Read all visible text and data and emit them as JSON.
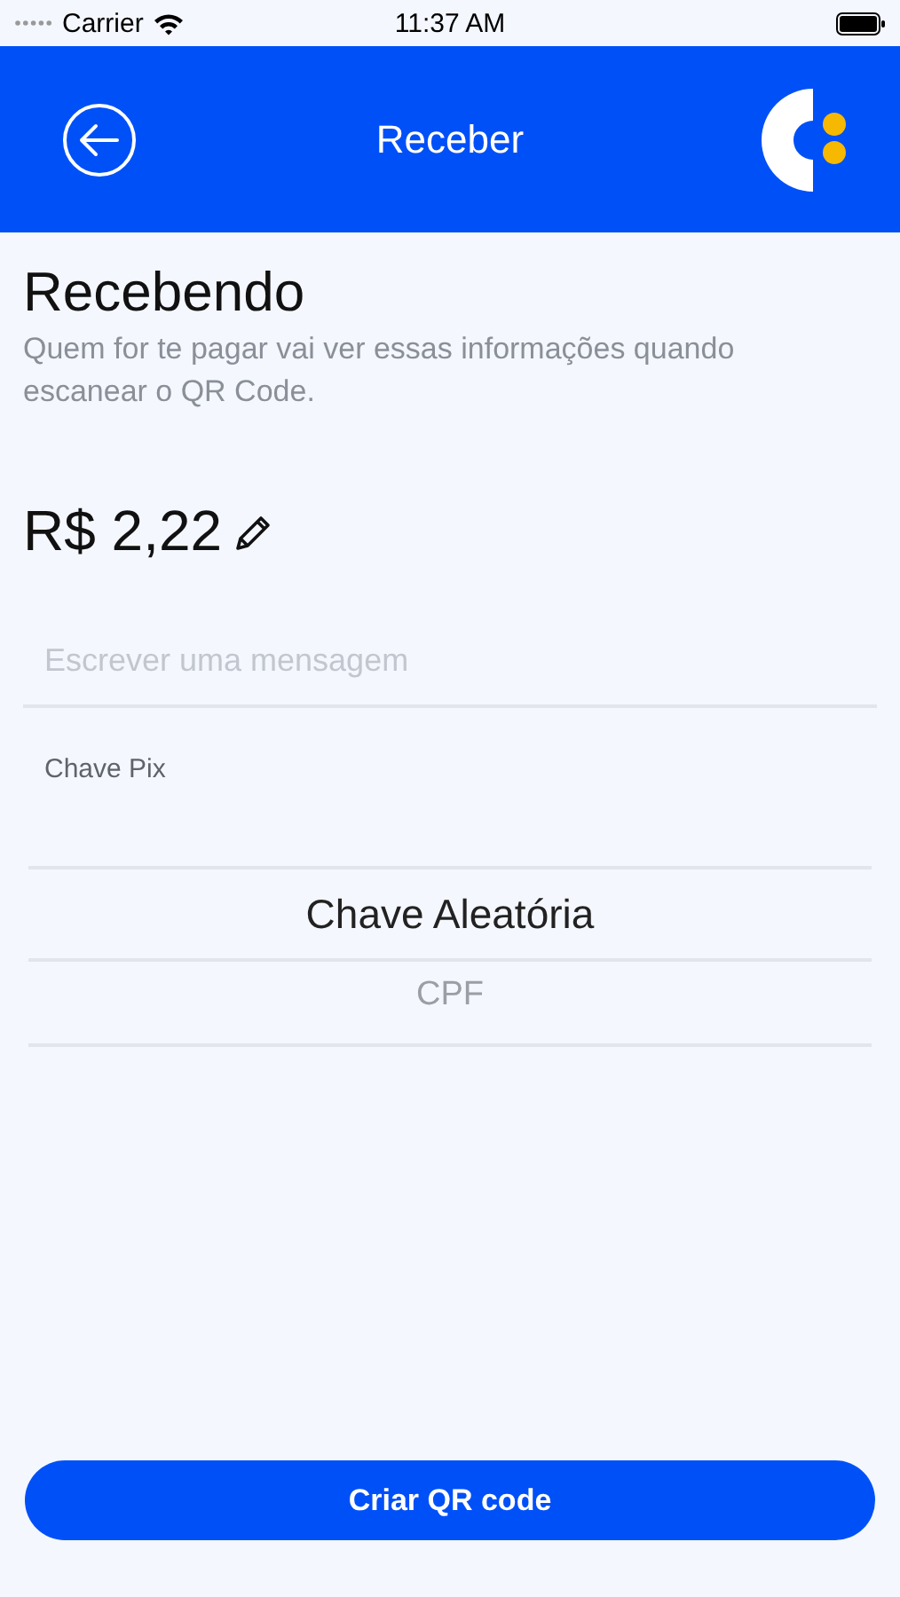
{
  "status_bar": {
    "carrier": "Carrier",
    "time": "11:37 AM"
  },
  "header": {
    "title": "Receber"
  },
  "heading": "Recebendo",
  "description": "Quem for te pagar vai ver essas informações quando escanear o QR Code.",
  "amount": "R$ 2,22",
  "message": {
    "placeholder": "Escrever uma mensagem"
  },
  "pix_key": {
    "label": "Chave Pix",
    "options": [
      {
        "label": "Chave Aleatória",
        "selected": true
      },
      {
        "label": "CPF",
        "selected": false
      }
    ]
  },
  "primary_button": "Criar QR code"
}
